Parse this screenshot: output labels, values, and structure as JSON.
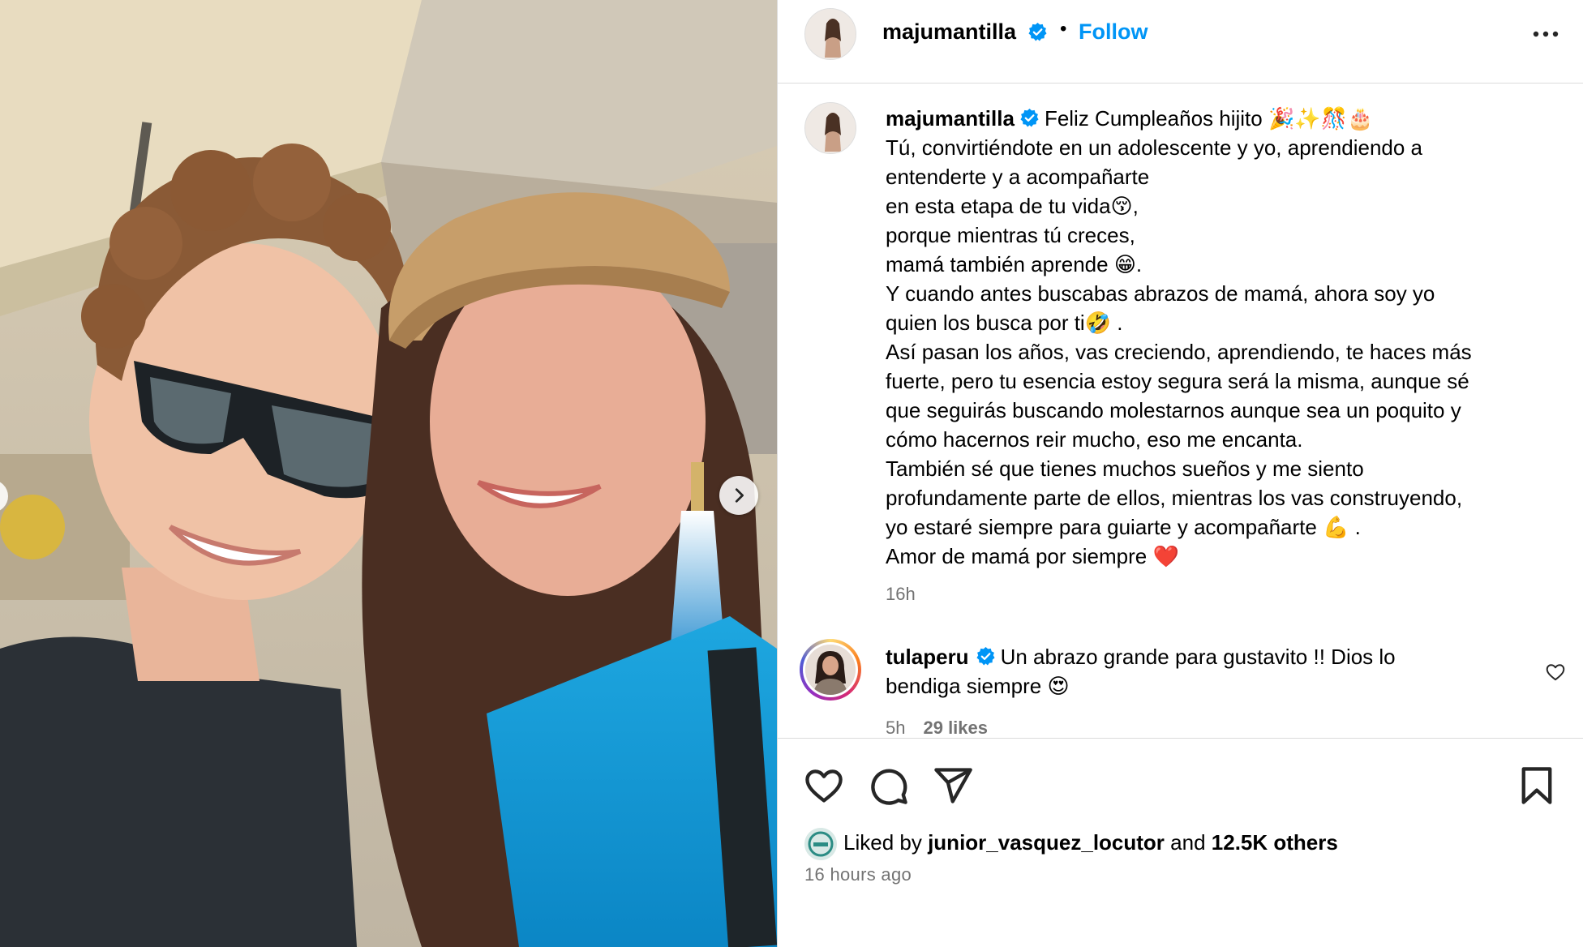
{
  "post_author": {
    "username": "majumantilla",
    "follow_label": "Follow",
    "separator": "•"
  },
  "caption": {
    "username": "majumantilla",
    "lines": [
      "Feliz Cumpleaños hijito 🎉✨🎊🎂",
      "Tú, convirtiéndote en un adolescente y yo, aprendiendo a",
      "entenderte y a acompañarte",
      "en esta etapa de tu vida😚,",
      "porque mientras tú creces,",
      "mamá también aprende 😁.",
      "Y cuando antes buscabas abrazos de mamá, ahora soy yo",
      "quien los busca por ti🤣 .",
      "Así pasan los años, vas creciendo, aprendiendo, te haces más",
      "fuerte, pero tu esencia estoy segura será la misma, aunque sé",
      "que seguirás buscando molestarnos aunque sea un poquito y",
      "cómo hacernos reir mucho, eso me encanta.",
      "También sé que tienes muchos sueños y me siento",
      "profundamente parte de ellos, mientras los vas construyendo,",
      "yo estaré siempre para guiarte y acompañarte 💪 .",
      "Amor de mamá por siempre ❤️"
    ],
    "time": "16h"
  },
  "comment": {
    "username": "tulaperu",
    "text_line1": "Un abrazo grande para gustavito !! Dios lo",
    "text_line2": "bendiga siempre 😍",
    "time": "5h",
    "likes": "29 likes"
  },
  "footer": {
    "liked_by_prefix": "Liked by",
    "liked_by_user": "junior_vasquez_locutor",
    "liked_by_and": "and",
    "liked_by_others": "12.5K others",
    "time_ago": "16 hours ago"
  },
  "colors": {
    "accent": "#0095f6",
    "verified": "#0095f6",
    "muted": "#737373",
    "border": "#dbdbdb"
  },
  "icons": {
    "like": "heart-icon",
    "comment": "comment-bubble-icon",
    "share": "paper-plane-icon",
    "save": "bookmark-icon",
    "more": "more-options-icon",
    "verified": "verified-badge-icon",
    "next": "chevron-right-icon"
  }
}
